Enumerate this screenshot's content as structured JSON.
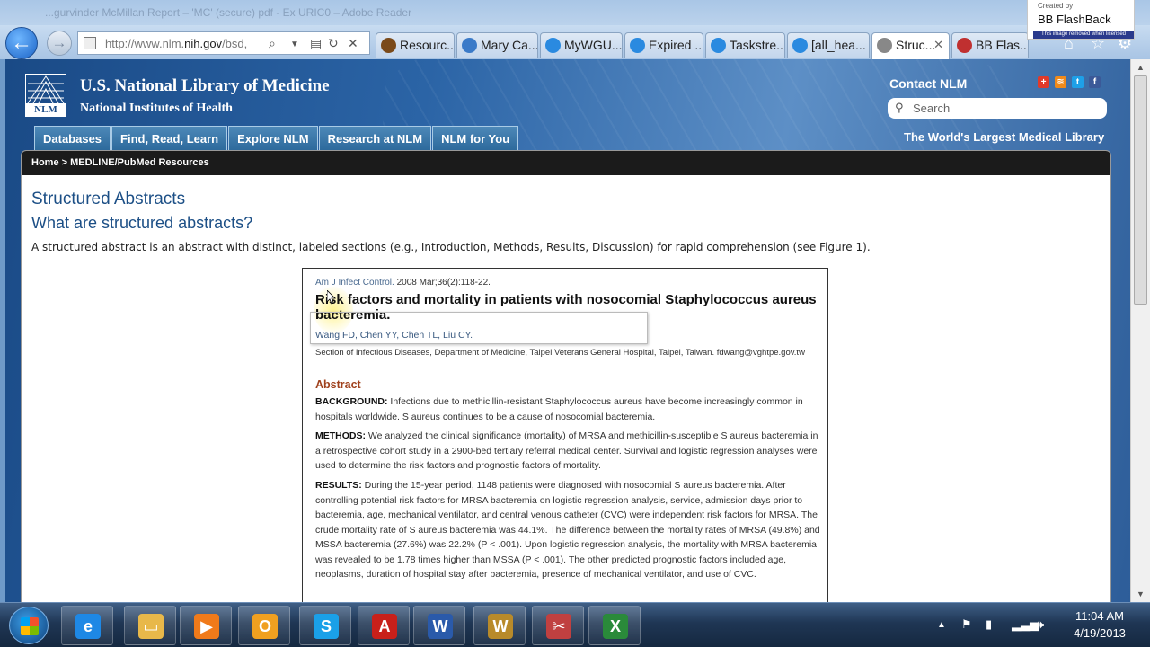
{
  "browser": {
    "ghost_title": "...gurvinder McMillan Report – 'MC' (secure) pdf - Ex URIC0 – Adobe Reader",
    "url_domain": "http://www.nlm.",
    "url_host": "nih.gov",
    "url_rest": "/bsd,",
    "tabs": [
      {
        "label": "Resourc...",
        "color": "#7a4a1a"
      },
      {
        "label": "Mary Ca...",
        "color": "#3a7ac8"
      },
      {
        "label": "MyWGU...",
        "color": "#2a8ae0"
      },
      {
        "label": "Expired ...",
        "color": "#2a8ae0"
      },
      {
        "label": "Taskstre...",
        "color": "#2a8ae0"
      },
      {
        "label": "[all_hea...",
        "color": "#2a8ae0"
      },
      {
        "label": "Struc...",
        "color": "#888888"
      },
      {
        "label": "BB Flas...",
        "color": "#c03030"
      }
    ],
    "close_glyph": "✕"
  },
  "flashback": {
    "created_by": "Created by",
    "brand": "BB FlashBack",
    "notice": "This image removed when licensed"
  },
  "header": {
    "logo_text": "NLM",
    "title": "U.S. National Library of Medicine",
    "subtitle": "National Institutes of Health",
    "contact": "Contact NLM",
    "search_placeholder": "Search",
    "tagline": "The World's Largest Medical Library",
    "social": [
      {
        "name": "share-icon",
        "glyph": "+",
        "color": "#e03a2a"
      },
      {
        "name": "rss-icon",
        "glyph": "≋",
        "color": "#f08a1a"
      },
      {
        "name": "twitter-icon",
        "glyph": "t",
        "color": "#1ea0e8"
      },
      {
        "name": "facebook-icon",
        "glyph": "f",
        "color": "#3b5998"
      }
    ]
  },
  "nav": [
    "Databases",
    "Find, Read, Learn",
    "Explore NLM",
    "Research at NLM",
    "NLM for You"
  ],
  "breadcrumb": "Home > MEDLINE/PubMed Resources",
  "main": {
    "h1": "Structured Abstracts",
    "h2": "What are structured abstracts?",
    "intro": "A structured abstract is an abstract with distinct, labeled sections (e.g., Introduction, Methods, Results, Discussion) for rapid comprehension (see Figure 1)."
  },
  "figure": {
    "journal": "Am J Infect Control.",
    "citation_rest": " 2008 Mar;36(2):118-22.",
    "title": "Risk factors and mortality in patients with nosocomial Staphylococcus aureus bacteremia.",
    "authors": "Wang FD, Chen YY, Chen TL, Liu CY.",
    "affiliation": "Section of Infectious Diseases, Department of Medicine, Taipei Veterans General Hospital, Taipei, Taiwan. fdwang@vghtpe.gov.tw",
    "abstract_heading": "Abstract",
    "sections": [
      {
        "label": "BACKGROUND:",
        "text": " Infections due to methicillin-resistant Staphylococcus aureus have become increasingly common in hospitals worldwide. S aureus continues to be a cause of nosocomial bacteremia."
      },
      {
        "label": "METHODS:",
        "text": " We analyzed the clinical significance (mortality) of MRSA and methicillin-susceptible S aureus bacteremia in a retrospective cohort study in a 2900-bed tertiary referral medical center. Survival and logistic regression analyses were used to determine the risk factors and prognostic factors of mortality."
      },
      {
        "label": "RESULTS:",
        "text": " During the 15-year period, 1148 patients were diagnosed with nosocomial S aureus bacteremia. After controlling potential risk factors for MRSA bacteremia on logistic regression analysis, service, admission days prior to bacteremia, age, mechanical ventilator, and central venous catheter (CVC) were independent risk factors for MRSA. The crude mortality rate of S aureus bacteremia was 44.1%. The difference between the mortality rates of MRSA (49.8%) and MSSA bacteremia (27.6%) was 22.2% (P < .001). Upon logistic regression analysis, the mortality with MRSA bacteremia was revealed to be 1.78 times higher than MSSA (P < .001). The other predicted prognostic factors included age, neoplasms, duration of hospital stay after bacteremia, presence of mechanical ventilator, and use of CVC."
      }
    ]
  },
  "taskbar": {
    "apps": [
      {
        "name": "ie-taskbar-icon",
        "glyph": "e",
        "color": "#1e88e5"
      },
      {
        "name": "explorer-taskbar-icon",
        "glyph": "▭",
        "color": "#e8b84a"
      },
      {
        "name": "media-player-taskbar-icon",
        "glyph": "▶",
        "color": "#f07a1a"
      },
      {
        "name": "outlook-taskbar-icon",
        "glyph": "O",
        "color": "#f0a020"
      },
      {
        "name": "skype-taskbar-icon",
        "glyph": "S",
        "color": "#1aa0e8"
      },
      {
        "name": "acrobat-taskbar-icon",
        "glyph": "A",
        "color": "#c8201a"
      },
      {
        "name": "word-taskbar-icon",
        "glyph": "W",
        "color": "#2a5aaa"
      },
      {
        "name": "wgu-taskbar-icon",
        "glyph": "W",
        "color": "#b88a2a"
      },
      {
        "name": "snipping-tool-taskbar-icon",
        "glyph": "✂",
        "color": "#c04040"
      },
      {
        "name": "excel-taskbar-icon",
        "glyph": "X",
        "color": "#2a8a3a"
      }
    ],
    "time": "11:04 AM",
    "date": "4/19/2013"
  }
}
